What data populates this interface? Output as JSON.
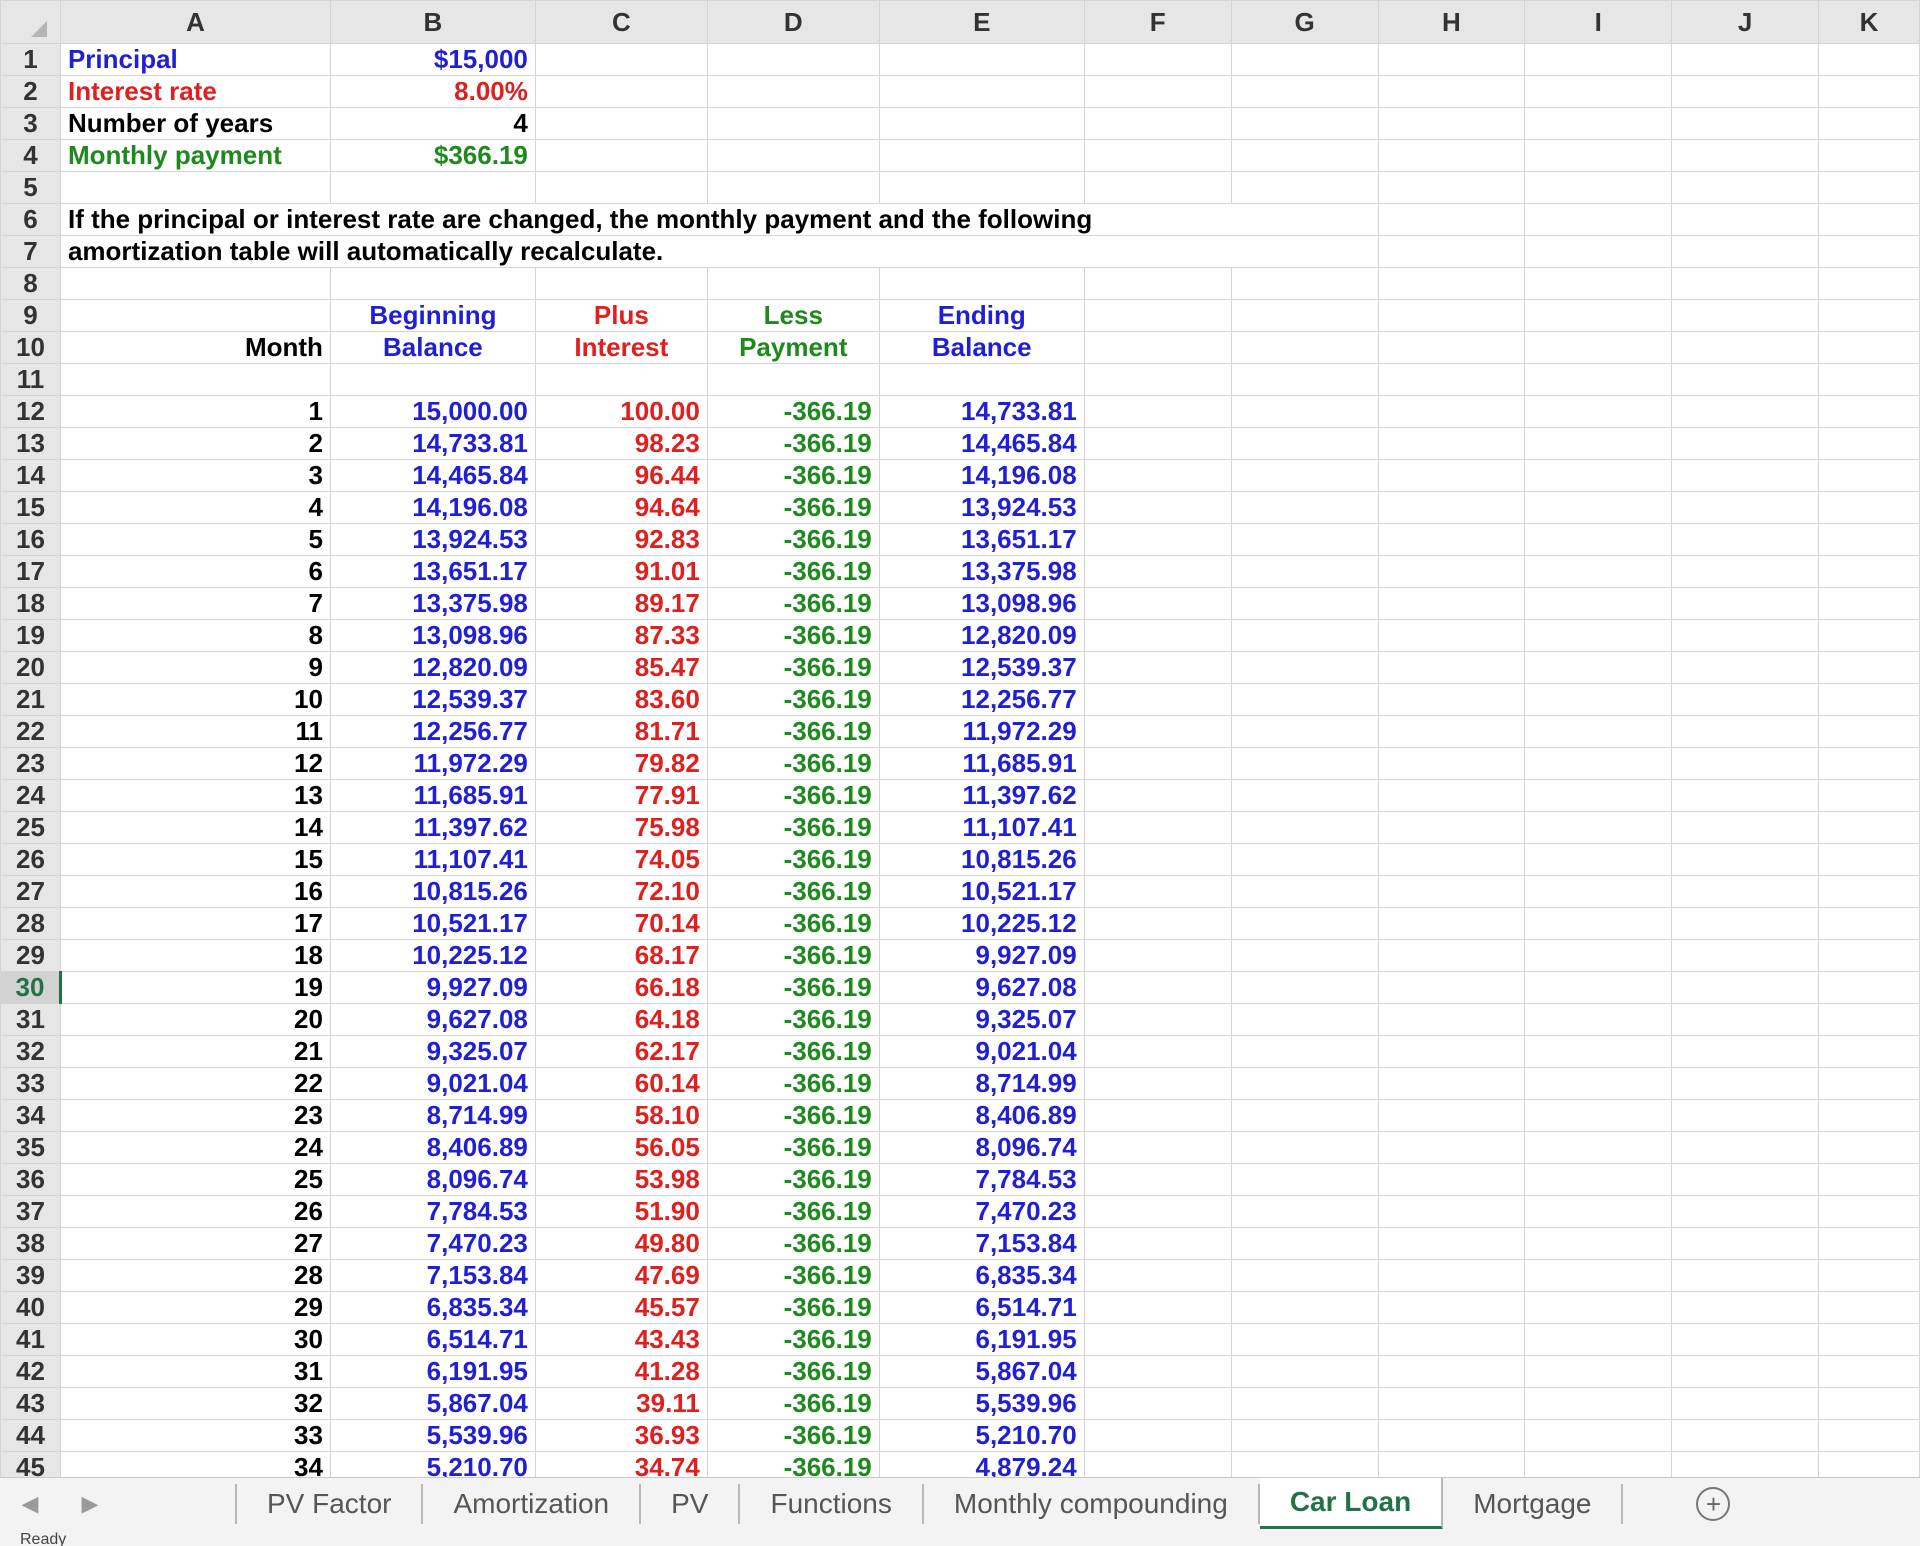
{
  "columns": [
    "A",
    "B",
    "C",
    "D",
    "E",
    "F",
    "G",
    "H",
    "I",
    "J",
    "K"
  ],
  "inputs": {
    "principal_label": "Principal",
    "principal_value": "$15,000",
    "rate_label": "Interest rate",
    "rate_value": "8.00%",
    "years_label": "Number of years",
    "years_value": "4",
    "payment_label": "Monthly payment",
    "payment_value": "$366.19"
  },
  "note": {
    "line1": "If the principal or interest rate are changed, the monthly payment and the following",
    "line2": "amortization table will automatically recalculate."
  },
  "table_headers": {
    "month": "Month",
    "begin_1": "Beginning",
    "begin_2": "Balance",
    "interest_1": "Plus",
    "interest_2": "Interest",
    "payment_1": "Less",
    "payment_2": "Payment",
    "end_1": "Ending",
    "end_2": "Balance"
  },
  "rows": [
    [
      "1",
      "15,000.00",
      "100.00",
      "-366.19",
      "14,733.81"
    ],
    [
      "2",
      "14,733.81",
      "98.23",
      "-366.19",
      "14,465.84"
    ],
    [
      "3",
      "14,465.84",
      "96.44",
      "-366.19",
      "14,196.08"
    ],
    [
      "4",
      "14,196.08",
      "94.64",
      "-366.19",
      "13,924.53"
    ],
    [
      "5",
      "13,924.53",
      "92.83",
      "-366.19",
      "13,651.17"
    ],
    [
      "6",
      "13,651.17",
      "91.01",
      "-366.19",
      "13,375.98"
    ],
    [
      "7",
      "13,375.98",
      "89.17",
      "-366.19",
      "13,098.96"
    ],
    [
      "8",
      "13,098.96",
      "87.33",
      "-366.19",
      "12,820.09"
    ],
    [
      "9",
      "12,820.09",
      "85.47",
      "-366.19",
      "12,539.37"
    ],
    [
      "10",
      "12,539.37",
      "83.60",
      "-366.19",
      "12,256.77"
    ],
    [
      "11",
      "12,256.77",
      "81.71",
      "-366.19",
      "11,972.29"
    ],
    [
      "12",
      "11,972.29",
      "79.82",
      "-366.19",
      "11,685.91"
    ],
    [
      "13",
      "11,685.91",
      "77.91",
      "-366.19",
      "11,397.62"
    ],
    [
      "14",
      "11,397.62",
      "75.98",
      "-366.19",
      "11,107.41"
    ],
    [
      "15",
      "11,107.41",
      "74.05",
      "-366.19",
      "10,815.26"
    ],
    [
      "16",
      "10,815.26",
      "72.10",
      "-366.19",
      "10,521.17"
    ],
    [
      "17",
      "10,521.17",
      "70.14",
      "-366.19",
      "10,225.12"
    ],
    [
      "18",
      "10,225.12",
      "68.17",
      "-366.19",
      "9,927.09"
    ],
    [
      "19",
      "9,927.09",
      "66.18",
      "-366.19",
      "9,627.08"
    ],
    [
      "20",
      "9,627.08",
      "64.18",
      "-366.19",
      "9,325.07"
    ],
    [
      "21",
      "9,325.07",
      "62.17",
      "-366.19",
      "9,021.04"
    ],
    [
      "22",
      "9,021.04",
      "60.14",
      "-366.19",
      "8,714.99"
    ],
    [
      "23",
      "8,714.99",
      "58.10",
      "-366.19",
      "8,406.89"
    ],
    [
      "24",
      "8,406.89",
      "56.05",
      "-366.19",
      "8,096.74"
    ],
    [
      "25",
      "8,096.74",
      "53.98",
      "-366.19",
      "7,784.53"
    ],
    [
      "26",
      "7,784.53",
      "51.90",
      "-366.19",
      "7,470.23"
    ],
    [
      "27",
      "7,470.23",
      "49.80",
      "-366.19",
      "7,153.84"
    ],
    [
      "28",
      "7,153.84",
      "47.69",
      "-366.19",
      "6,835.34"
    ],
    [
      "29",
      "6,835.34",
      "45.57",
      "-366.19",
      "6,514.71"
    ],
    [
      "30",
      "6,514.71",
      "43.43",
      "-366.19",
      "6,191.95"
    ],
    [
      "31",
      "6,191.95",
      "41.28",
      "-366.19",
      "5,867.04"
    ],
    [
      "32",
      "5,867.04",
      "39.11",
      "-366.19",
      "5,539.96"
    ],
    [
      "33",
      "5,539.96",
      "36.93",
      "-366.19",
      "5,210.70"
    ],
    [
      "34",
      "5,210.70",
      "34.74",
      "-366.19",
      "4,879.24"
    ]
  ],
  "active_row": "30",
  "tabs": [
    "PV Factor",
    "Amortization",
    "PV",
    "Functions",
    "Monthly compounding",
    "Car Loan",
    "Mortgage"
  ],
  "active_tab": "Car Loan",
  "status": "Ready",
  "colors": {
    "blue": "#1f1fd6",
    "red": "#e0201e",
    "green": "#1e8a1e",
    "excel_green": "#217346"
  },
  "icons": {
    "prev": "chevron-left-icon",
    "next": "chevron-right-icon",
    "add": "plus-circle-icon"
  }
}
